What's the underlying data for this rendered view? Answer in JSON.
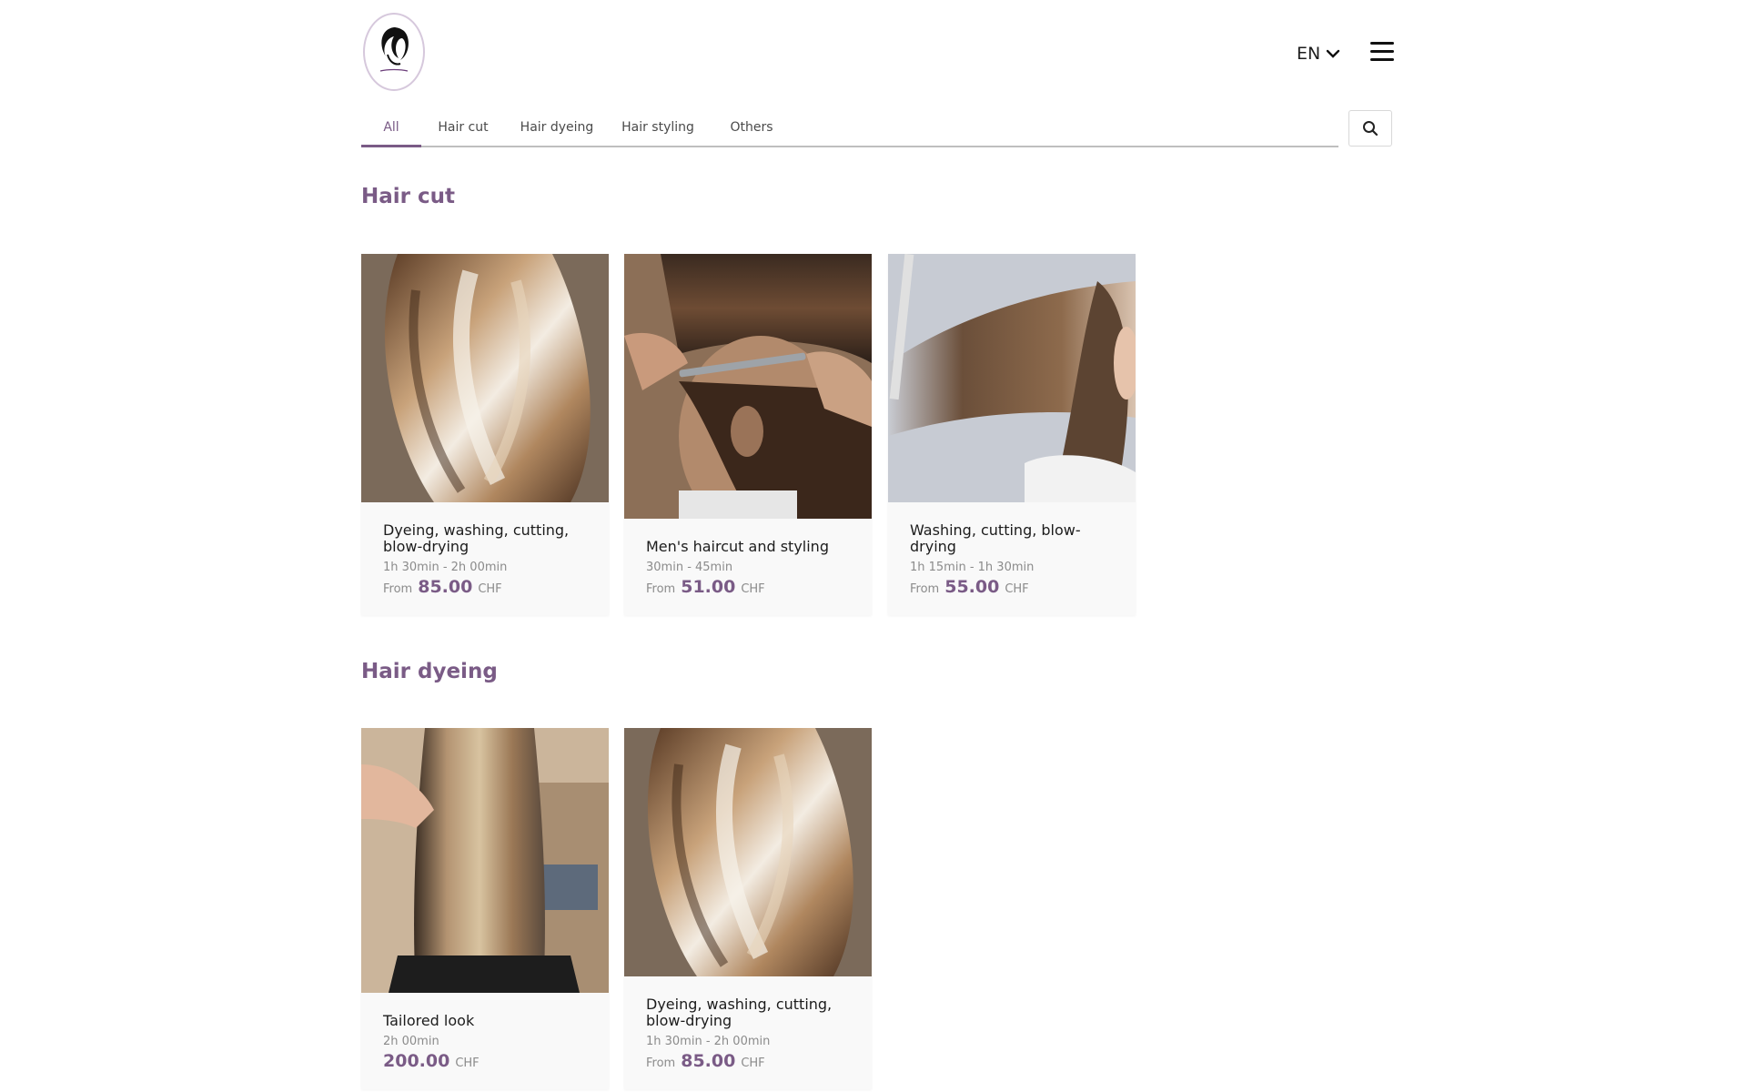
{
  "header": {
    "language": "EN",
    "logo_icon": "salon-logo-icon",
    "menu_icon": "hamburger-icon"
  },
  "tabs": [
    {
      "label": "All",
      "active": true
    },
    {
      "label": "Hair cut",
      "active": false
    },
    {
      "label": "Hair dyeing",
      "active": false
    },
    {
      "label": "Hair styling",
      "active": false
    },
    {
      "label": "Others",
      "active": false
    }
  ],
  "search_icon": "search-icon",
  "sections": [
    {
      "title": "Hair cut",
      "cards": [
        {
          "title": "Dyeing, washing, cutting, blow-drying",
          "duration": "1h 30min - 2h 00min",
          "from": "From",
          "price": "85.00",
          "currency": "CHF",
          "image": "balayage-bob"
        },
        {
          "title": "Men's haircut and styling",
          "duration": "30min - 45min",
          "from": "From",
          "price": "51.00",
          "currency": "CHF",
          "image": "mens-haircut"
        },
        {
          "title": "Washing, cutting, blow-drying",
          "duration": "1h 15min - 1h 30min",
          "from": "From",
          "price": "55.00",
          "currency": "CHF",
          "image": "long-hair-cut"
        }
      ]
    },
    {
      "title": "Hair dyeing",
      "cards": [
        {
          "title": "Tailored look",
          "duration": "2h 00min",
          "from": "",
          "price": "200.00",
          "currency": "CHF",
          "image": "long-balayage"
        },
        {
          "title": "Dyeing, washing, cutting, blow-drying",
          "duration": "1h 30min - 2h 00min",
          "from": "From",
          "price": "85.00",
          "currency": "CHF",
          "image": "balayage-bob"
        }
      ]
    }
  ],
  "colors": {
    "accent": "#7a5b86",
    "card_bg": "#f9f9f9",
    "muted_text": "#8b8b8b"
  }
}
